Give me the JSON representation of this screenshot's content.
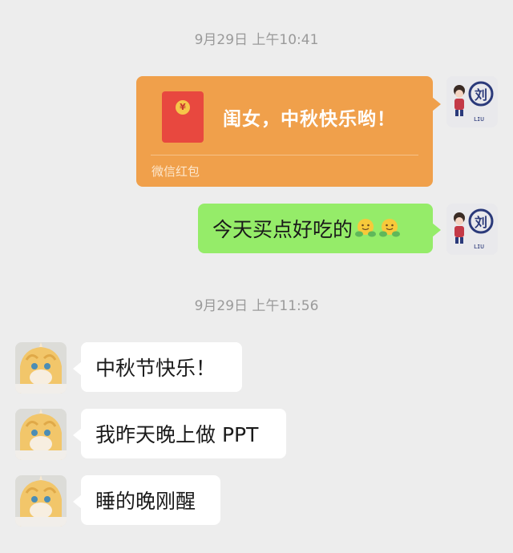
{
  "messages": [
    {
      "type": "timestamp",
      "text": "9月29日 上午10:41"
    },
    {
      "type": "red_packet",
      "side": "right",
      "title": "闺女，中秋快乐哟！",
      "footer": "微信红包",
      "coin_symbol": "¥"
    },
    {
      "type": "text",
      "side": "right",
      "text": "今天买点好吃的",
      "emoji": [
        "hugging-face-emoji",
        "hugging-face-emoji"
      ]
    },
    {
      "type": "timestamp",
      "text": "9月29日 上午11:56"
    },
    {
      "type": "text",
      "side": "left",
      "text": "中秋节快乐！"
    },
    {
      "type": "text",
      "side": "left",
      "text": "我昨天晚上做 PPT"
    },
    {
      "type": "text",
      "side": "left",
      "text": "睡的晚刚醒"
    }
  ],
  "colors": {
    "background": "#ededed",
    "sent_bubble": "#95ec69",
    "received_bubble": "#ffffff",
    "red_packet": "#f0a04b",
    "timestamp": "#9a9a9a"
  }
}
